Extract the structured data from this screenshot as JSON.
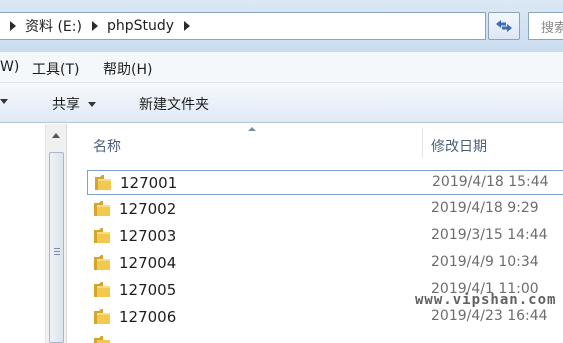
{
  "address_bar": {
    "segments": [
      "资料 (E:)",
      "phpStudy"
    ]
  },
  "search": {
    "placeholder": "搜索"
  },
  "menu": {
    "items": [
      "W)",
      "工具(T)",
      "帮助(H)"
    ]
  },
  "toolbar": {
    "share_label": "共享",
    "new_folder_label": "新建文件夹"
  },
  "columns": {
    "name": "名称",
    "date": "修改日期"
  },
  "files": [
    {
      "name": "127001",
      "date": "2019/4/18 15:44"
    },
    {
      "name": "127002",
      "date": "2019/4/18 9:29"
    },
    {
      "name": "127003",
      "date": "2019/3/15 14:44"
    },
    {
      "name": "127004",
      "date": "2019/4/9 10:34"
    },
    {
      "name": "127005",
      "date": "2019/4/1 11:00"
    },
    {
      "name": "127006",
      "date": "2019/4/23 16:44"
    }
  ],
  "watermark": "www.vipshan.com",
  "icons": [
    "chevron-right-icon",
    "refresh-icon",
    "folder-icon",
    "dropdown-arrow-icon",
    "sort-arrow-icon"
  ],
  "colors": {
    "folder_fill": "#e8b83a",
    "selection_border": "#7da2ce",
    "address_bg": "#c9dcef"
  }
}
